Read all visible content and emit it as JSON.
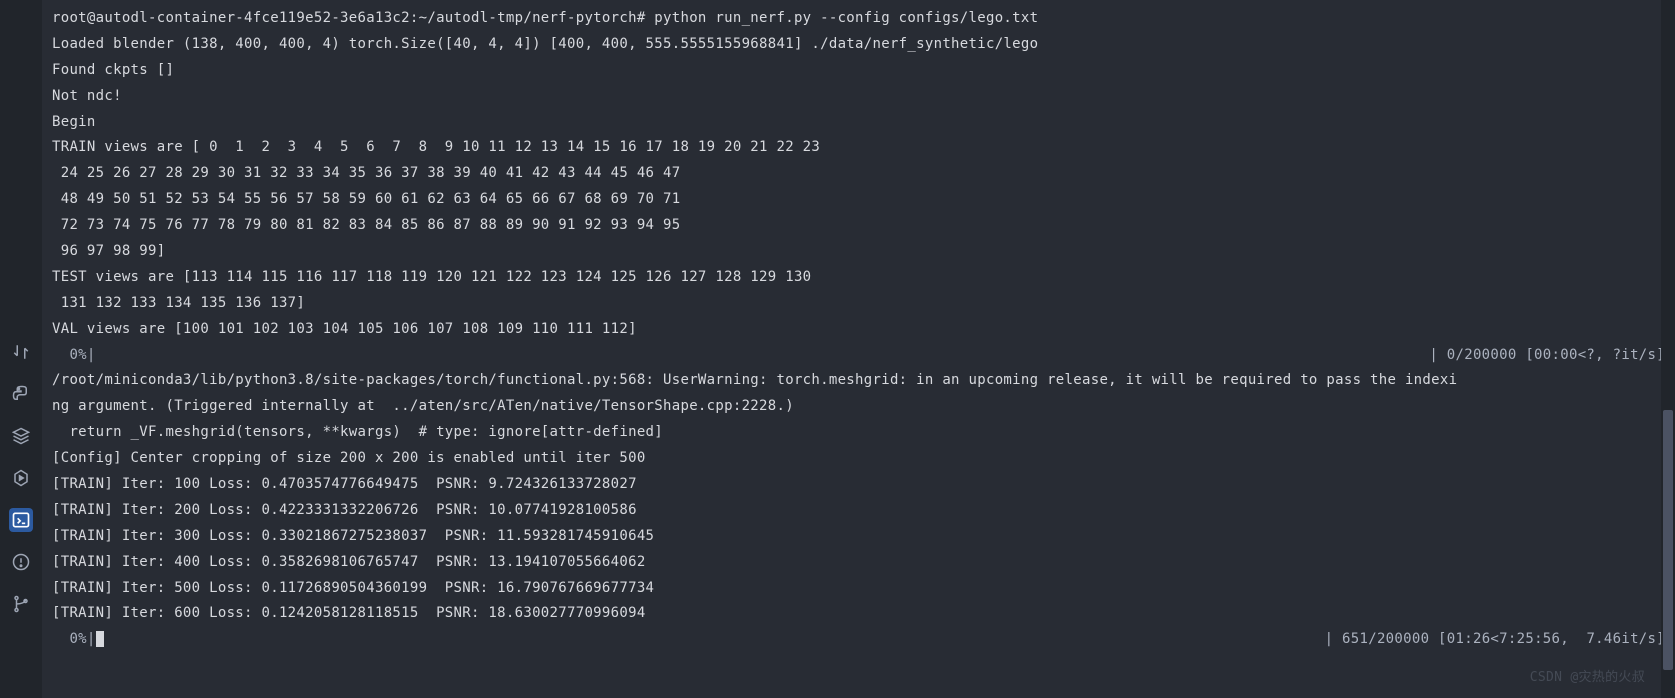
{
  "sidebar": {
    "icons": [
      {
        "name": "swap-icon"
      },
      {
        "name": "python-icon"
      },
      {
        "name": "layers-icon"
      },
      {
        "name": "play-hex-icon"
      },
      {
        "name": "terminal-icon"
      },
      {
        "name": "alert-icon"
      },
      {
        "name": "branch-icon"
      }
    ]
  },
  "terminal": {
    "lines": [
      "root@autodl-container-4fce119e52-3e6a13c2:~/autodl-tmp/nerf-pytorch# python run_nerf.py --config configs/lego.txt",
      "Loaded blender (138, 400, 400, 4) torch.Size([40, 4, 4]) [400, 400, 555.5555155968841] ./data/nerf_synthetic/lego",
      "Found ckpts []",
      "Not ndc!",
      "Begin",
      "TRAIN views are [ 0  1  2  3  4  5  6  7  8  9 10 11 12 13 14 15 16 17 18 19 20 21 22 23",
      " 24 25 26 27 28 29 30 31 32 33 34 35 36 37 38 39 40 41 42 43 44 45 46 47",
      " 48 49 50 51 52 53 54 55 56 57 58 59 60 61 62 63 64 65 66 67 68 69 70 71",
      " 72 73 74 75 76 77 78 79 80 81 82 83 84 85 86 87 88 89 90 91 92 93 94 95",
      " 96 97 98 99]",
      "TEST views are [113 114 115 116 117 118 119 120 121 122 123 124 125 126 127 128 129 130",
      " 131 132 133 134 135 136 137]",
      "VAL views are [100 101 102 103 104 105 106 107 108 109 110 111 112]"
    ],
    "progress1_left": "  0%|",
    "progress1_right": "| 0/200000 [00:00<?, ?it/s]",
    "warn_lines": [
      "/root/miniconda3/lib/python3.8/site-packages/torch/functional.py:568: UserWarning: torch.meshgrid: in an upcoming release, it will be required to pass the indexi",
      "ng argument. (Triggered internally at  ../aten/src/ATen/native/TensorShape.cpp:2228.)",
      "  return _VF.meshgrid(tensors, **kwargs)  # type: ignore[attr-defined]",
      "[Config] Center cropping of size 200 x 200 is enabled until iter 500",
      "[TRAIN] Iter: 100 Loss: 0.4703574776649475  PSNR: 9.724326133728027",
      "[TRAIN] Iter: 200 Loss: 0.4223331332206726  PSNR: 10.07741928100586",
      "[TRAIN] Iter: 300 Loss: 0.33021867275238037  PSNR: 11.593281745910645",
      "[TRAIN] Iter: 400 Loss: 0.3582698106765747  PSNR: 13.194107055664062",
      "[TRAIN] Iter: 500 Loss: 0.11726890504360199  PSNR: 16.790767669677734",
      "[TRAIN] Iter: 600 Loss: 0.1242058128118515  PSNR: 18.630027770996094"
    ],
    "progress2_left": "  0%|",
    "progress2_right": "| 651/200000 [01:26<7:25:56,  7.46it/s]"
  },
  "watermark": "CSDN @灾热的火叔"
}
